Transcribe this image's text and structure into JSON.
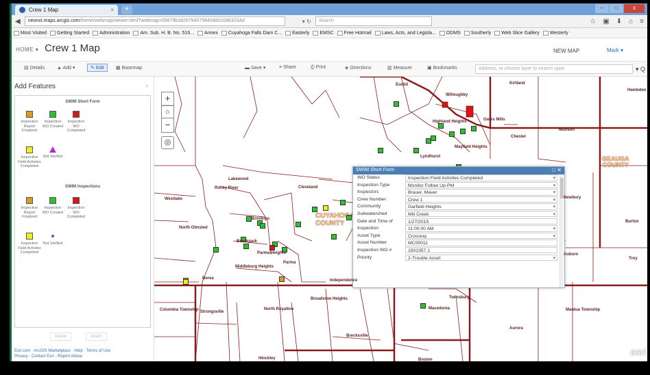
{
  "browser": {
    "tab_title": "Crew 1 Map",
    "tab_close": "×",
    "new_tab": "+",
    "url_domain": "neonxt.maps.arcgis.com",
    "url_path": "/home/webmap/viewer.html?webmap=05879b3d26754075845482c0d6320Ad",
    "reload": "▾ ↻",
    "search_placeholder": "Search",
    "win_min": "–",
    "win_max": "□",
    "win_close": "x",
    "bookmarks": [
      "Most Visited",
      "Getting Started",
      "Administration",
      "Am. Sub. H. B. No. 516...",
      "Annex",
      "Cuyahoga Falls Dam C...",
      "Easterly",
      "EMSC",
      "Free Hotmail",
      "Laws, Acts, and Legisla...",
      "ODMS",
      "Southerly",
      "Web Slice Gallery",
      "Westerly"
    ]
  },
  "header": {
    "home": "HOME ▾",
    "title": "Crew 1 Map",
    "new_map": "NEW MAP",
    "user": "Mark ▾"
  },
  "toolbar": {
    "details": "Details",
    "add": "Add ▾",
    "edit": "Edit",
    "basemap": "Basemap",
    "save": "Save ▾",
    "share": "Share",
    "print": "Print",
    "directions": "Directions",
    "measure": "Measure",
    "bookmarks": "Bookmarks",
    "address_placeholder": "Address, or choose layer to search upon",
    "search_btn": "▾ Q"
  },
  "panel": {
    "title": "Add Features",
    "collapse": "‹",
    "group1": "SWIM Short Form",
    "group2": "SWIM Inspections",
    "items": [
      {
        "label": "Inspection Report Finalized",
        "color": "#d89b1f"
      },
      {
        "label": "Inspection WO Created",
        "color": "#2fbf2f"
      },
      {
        "label": "Inspection WO Completed",
        "color": "#d41818"
      },
      {
        "label": "Inspection Field Activites Completed",
        "color": "#f0f018"
      },
      {
        "label": "Not Verified",
        "color": "#b32ad6"
      }
    ],
    "btn_delete": "Delete",
    "btn_attach": "Attach",
    "footer1": "Esri.com · ArcGIS Marketplace · Help · Terms of Use",
    "footer2": "Privacy · Contact Esri · Report Abuse"
  },
  "map": {
    "zoom_in": "+",
    "zoom_out": "−",
    "home": "⌂",
    "locate": "◎",
    "geauga": "GEAUGA\nCOUNTY",
    "cuyahoga": "CUYAHOGA\nCOUNTY",
    "esri": "esri",
    "towns": [
      "Euclid",
      "Willoughby",
      "Kirtland",
      "Hambden",
      "Highland Heights",
      "Gates Mills",
      "Chester",
      "Munson",
      "Mayfield Heights",
      "Lyndhurst",
      "Lakewood",
      "Cleveland",
      "Rocky River",
      "Newbury",
      "Westlake",
      "Brooklyn",
      "North Olmsted",
      "Burton",
      "Brookpark",
      "Parma Heights",
      "Parma",
      "Middleburg Heights",
      "Berea",
      "Auburn",
      "Troy",
      "Independence",
      "Broadview Heights",
      "Twinsburg",
      "Columbia Township",
      "Strongsville",
      "North Royalton",
      "Macedonia",
      "Mantua Township",
      "Aurora",
      "Brecksville",
      "Hinckley",
      "Boston"
    ]
  },
  "popup": {
    "title": "SWIM Short Form",
    "controls": "□ ✕",
    "fields": [
      {
        "label": "WO Status",
        "value": "Inspection Field Activites Completed",
        "dropdown": true
      },
      {
        "label": "Inspection Type",
        "value": "Monitor Follow Up-PM",
        "dropdown": true
      },
      {
        "label": "Inspectors",
        "value": "Brauer, Maver",
        "dropdown": true
      },
      {
        "label": "Crew Number",
        "value": "Crew 1",
        "dropdown": true
      },
      {
        "label": "Community",
        "value": "Garfield Heights",
        "dropdown": true
      },
      {
        "label": "Subwatershed",
        "value": "Mill Creek",
        "dropdown": true
      },
      {
        "label": "Date and Time of",
        "value": "1/27/2015",
        "dropdown": false
      },
      {
        "label": "Inspection",
        "value": "11:00:00 AM",
        "dropdown": true
      },
      {
        "label": "Asset Type",
        "value": "Crossing",
        "dropdown": true
      },
      {
        "label": "Asset Number",
        "value": "MC00011",
        "dropdown": false
      },
      {
        "label": "Inspection WO #",
        "value": "1502357.1",
        "dropdown": false
      },
      {
        "label": "Priority",
        "value": "2-Trouble Asset",
        "dropdown": true
      }
    ]
  }
}
